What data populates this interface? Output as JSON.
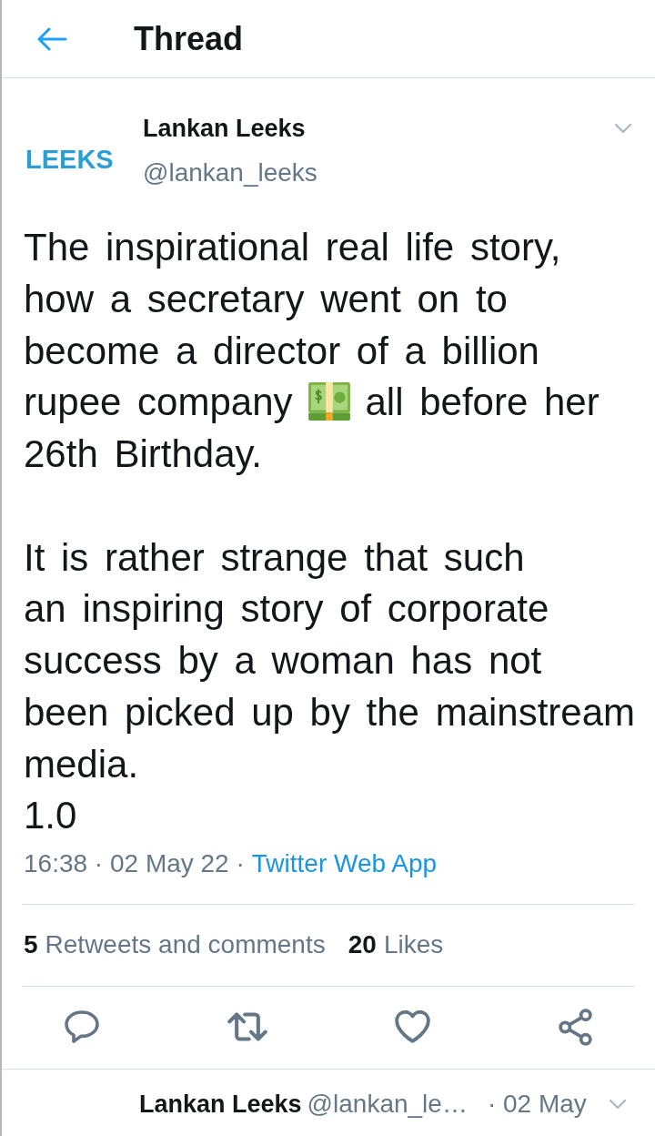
{
  "header": {
    "title": "Thread"
  },
  "tweet": {
    "avatar_text": "LEEKS",
    "name": "Lankan Leeks",
    "handle": "@lankan_leeks",
    "paragraphs": [
      {
        "segments": [
          {
            "kind": "text",
            "text": "The inspirational real life story, how a secretary went on to become a director of a billion rupee company"
          },
          {
            "kind": "emoji"
          },
          {
            "kind": "text",
            "text": "all before her 26th Birthday."
          }
        ]
      },
      {
        "segments": [
          {
            "kind": "text",
            "text": "It is rather strange that such\nan inspiring story of corporate success by a woman has not been picked up by the mainstream media.\n1.0"
          }
        ]
      }
    ],
    "timestamp": "16:38 · 02 May 22 ·",
    "source": "Twitter Web App",
    "stats": [
      {
        "count": "5",
        "label": "Retweets and comments"
      },
      {
        "count": "20",
        "label": "Likes"
      }
    ],
    "actions": [
      {
        "kind": "reply"
      },
      {
        "kind": "retweet"
      },
      {
        "kind": "like"
      },
      {
        "kind": "share"
      }
    ]
  },
  "reply_preview": {
    "name": "Lankan Leeks",
    "handle": "@lankan_le…",
    "date": "· 02 May"
  }
}
